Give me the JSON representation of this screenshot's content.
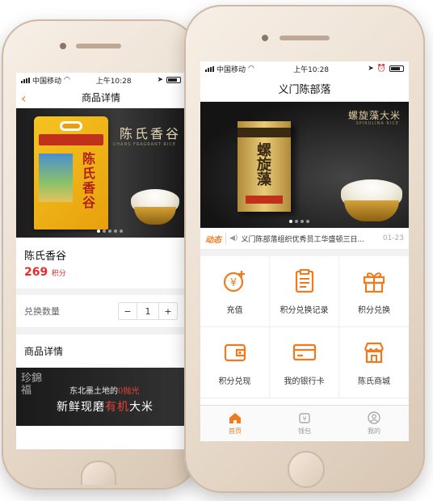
{
  "back_phone": {
    "status": {
      "carrier": "中国移动",
      "time": "上午10:28"
    },
    "nav": {
      "title": "商品详情"
    },
    "banner": {
      "title": "陈氏香谷",
      "subtitle": "CHANS FRAGRANT RICE",
      "bag_text": "陈氏香谷"
    },
    "product": {
      "name": "陈氏香谷",
      "price": "269",
      "price_unit": "积分"
    },
    "quantity": {
      "label": "兑换数量",
      "minus": "−",
      "value": "1",
      "plus": "+"
    },
    "details": {
      "heading": "商品详情",
      "banner_logo": "珍錦福",
      "banner_line1_pre": "东北墨土地的",
      "banner_line1_hl": "0抛光",
      "banner_line2_pre": "新鲜现磨",
      "banner_line2_hl": "有机",
      "banner_line2_post": "大米"
    }
  },
  "front_phone": {
    "status": {
      "carrier": "中国移动",
      "time": "上午10:28"
    },
    "nav": {
      "title": "义门陈部落"
    },
    "banner": {
      "title": "螺旋藻大米",
      "subtitle": "SPIRULINA RICE",
      "box_text": "螺旋藻"
    },
    "news": {
      "tag": "动态",
      "text": "义门陈部落组织优秀员工华盛顿三日...",
      "date": "01-23"
    },
    "grid": [
      {
        "label": "充值",
        "icon": "recharge-icon"
      },
      {
        "label": "积分兑换记录",
        "icon": "record-icon"
      },
      {
        "label": "积分兑换",
        "icon": "gift-icon"
      },
      {
        "label": "积分兑现",
        "icon": "wallet-icon"
      },
      {
        "label": "我的银行卡",
        "icon": "bank-card-icon"
      },
      {
        "label": "陈氏商城",
        "icon": "store-icon"
      }
    ],
    "tabs": [
      {
        "label": "首页",
        "icon": "home-icon",
        "active": true
      },
      {
        "label": "钱包",
        "icon": "wallet-tab-icon",
        "active": false
      },
      {
        "label": "我的",
        "icon": "user-icon",
        "active": false
      }
    ],
    "colors": {
      "accent": "#f07a1e",
      "price": "#e52b2b"
    }
  }
}
